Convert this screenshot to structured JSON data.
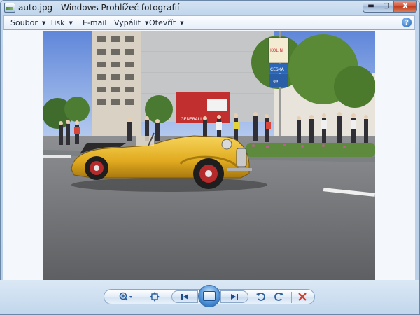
{
  "window": {
    "title": "auto.jpg - Windows Prohlížeč fotografií",
    "controls": {
      "minimize": "▬",
      "maximize": "▢",
      "close": "X"
    }
  },
  "menu": {
    "items": [
      {
        "label": "Soubor",
        "arrow": "▼"
      },
      {
        "label": "Tisk",
        "arrow": "▼"
      },
      {
        "label": "E-mail",
        "arrow": ""
      },
      {
        "label": "Vypálit",
        "arrow": "▼"
      },
      {
        "label": "Otevřít",
        "arrow": "▼"
      }
    ],
    "help": "?"
  },
  "photo": {
    "signs": {
      "top": "KOLIN",
      "middle": "CESKA",
      "lower": "⇦"
    },
    "billboard": {
      "brand": "GENERALI"
    }
  },
  "toolbar": {
    "zoom_icon": "zoom-icon",
    "fit_icon": "actual-size-icon",
    "previous_icon": "previous-icon",
    "slideshow_icon": "slideshow-icon",
    "next_icon": "next-icon",
    "rotate_left_icon": "rotate-counterclockwise-icon",
    "rotate_right_icon": "rotate-clockwise-icon",
    "delete_icon": "delete-icon"
  },
  "colors": {
    "accent": "#2b5f9e",
    "car_yellow": "#e8b82a",
    "delete_red": "#d23a2a"
  }
}
